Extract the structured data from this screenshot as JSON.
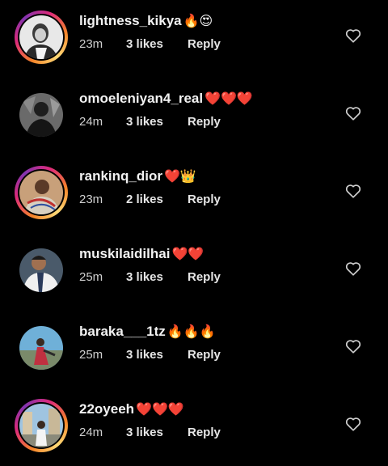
{
  "comments": [
    {
      "username": "lightness_kikya",
      "emoji": "🔥😍",
      "time": "23m",
      "likes": "3 likes",
      "reply_label": "Reply",
      "story_ring": true,
      "avatar_icon": "profile-photo"
    },
    {
      "username": "omoeleniyan4_real",
      "emoji": "❤️❤️❤️",
      "time": "24m",
      "likes": "3 likes",
      "reply_label": "Reply",
      "story_ring": false,
      "avatar_icon": "profile-photo"
    },
    {
      "username": "rankinq_dior",
      "emoji": "❤️👑",
      "time": "23m",
      "likes": "2 likes",
      "reply_label": "Reply",
      "story_ring": true,
      "avatar_icon": "profile-photo"
    },
    {
      "username": "muskilaidilhai",
      "emoji": "❤️❤️",
      "time": "25m",
      "likes": "3 likes",
      "reply_label": "Reply",
      "story_ring": false,
      "avatar_icon": "profile-photo"
    },
    {
      "username": "baraka___1tz",
      "emoji": "🔥🔥🔥",
      "time": "25m",
      "likes": "3 likes",
      "reply_label": "Reply",
      "story_ring": false,
      "avatar_icon": "profile-photo"
    },
    {
      "username": "22oyeeh",
      "emoji": "❤️❤️❤️",
      "time": "24m",
      "likes": "3 likes",
      "reply_label": "Reply",
      "story_ring": true,
      "avatar_icon": "profile-photo"
    }
  ],
  "colors": {
    "background": "#000000",
    "text": "#f2f2f2",
    "secondary_text": "#cfcfcf",
    "story_ring_start": "#f58529",
    "story_ring_end": "#dd2a7b"
  },
  "icons": {
    "like": "heart-outline-icon"
  }
}
